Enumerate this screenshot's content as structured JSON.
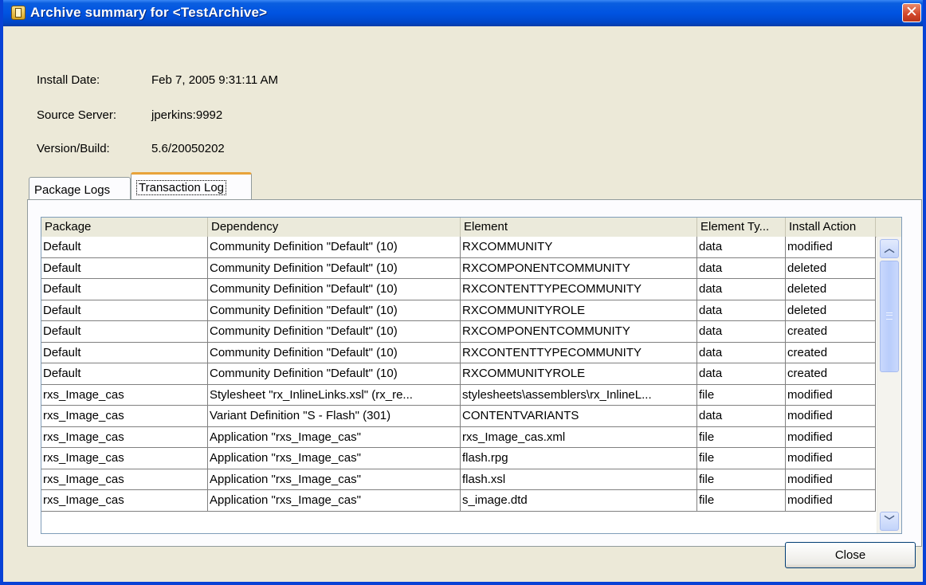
{
  "window": {
    "title": "Archive summary for <TestArchive>",
    "close_glyph": "✕"
  },
  "info": {
    "install_date_label": "Install Date:",
    "install_date_value": "Feb 7, 2005 9:31:11 AM",
    "source_server_label": "Source Server:",
    "source_server_value": "jperkins:9992",
    "version_label": "Version/Build:",
    "version_value": "5.6/20050202"
  },
  "tabs": [
    {
      "label": "Package Logs",
      "active": false
    },
    {
      "label": "Transaction Log",
      "active": true
    }
  ],
  "table": {
    "columns": [
      "Package",
      "Dependency",
      "Element",
      "Element Ty...",
      "Install Action"
    ],
    "rows": [
      [
        "Default",
        "Community Definition \"Default\" (10)",
        "RXCOMMUNITY",
        "data",
        "modified"
      ],
      [
        "Default",
        "Community Definition \"Default\" (10)",
        "RXCOMPONENTCOMMUNITY",
        "data",
        "deleted"
      ],
      [
        "Default",
        "Community Definition \"Default\" (10)",
        "RXCONTENTTYPECOMMUNITY",
        "data",
        "deleted"
      ],
      [
        "Default",
        "Community Definition \"Default\" (10)",
        "RXCOMMUNITYROLE",
        "data",
        "deleted"
      ],
      [
        "Default",
        "Community Definition \"Default\" (10)",
        "RXCOMPONENTCOMMUNITY",
        "data",
        "created"
      ],
      [
        "Default",
        "Community Definition \"Default\" (10)",
        "RXCONTENTTYPECOMMUNITY",
        "data",
        "created"
      ],
      [
        "Default",
        "Community Definition \"Default\" (10)",
        "RXCOMMUNITYROLE",
        "data",
        "created"
      ],
      [
        "rxs_Image_cas",
        "Stylesheet \"rx_InlineLinks.xsl\" (rx_re...",
        "stylesheets\\assemblers\\rx_InlineL...",
        "file",
        "modified"
      ],
      [
        "rxs_Image_cas",
        "Variant Definition \"S - Flash\" (301)",
        "CONTENTVARIANTS",
        "data",
        "modified"
      ],
      [
        "rxs_Image_cas",
        "Application \"rxs_Image_cas\"",
        "rxs_Image_cas.xml",
        "file",
        "modified"
      ],
      [
        "rxs_Image_cas",
        "Application \"rxs_Image_cas\"",
        "flash.rpg",
        "file",
        "modified"
      ],
      [
        "rxs_Image_cas",
        "Application \"rxs_Image_cas\"",
        "flash.xsl",
        "file",
        "modified"
      ],
      [
        "rxs_Image_cas",
        "Application \"rxs_Image_cas\"",
        "s_image.dtd",
        "file",
        "modified"
      ]
    ]
  },
  "scrollbar": {
    "up_glyph": "︿",
    "down_glyph": "﹀"
  },
  "buttons": {
    "close_label": "Close"
  }
}
